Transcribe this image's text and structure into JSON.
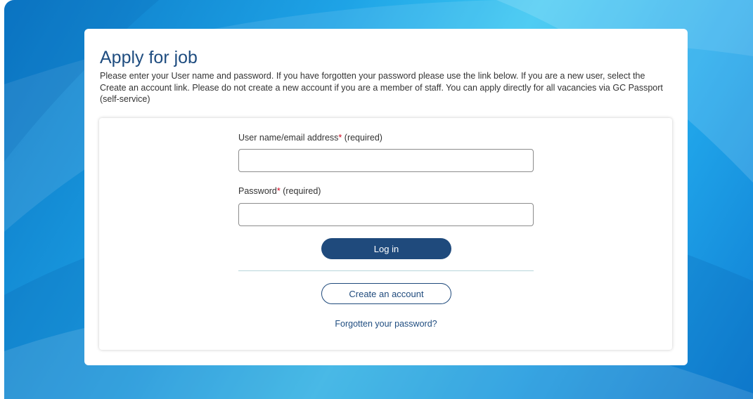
{
  "page": {
    "title": "Apply for job",
    "intro": "Please enter your User name and password. If you have forgotten your password please use the link below. If you are a new user, select the Create an account link. Please do not create a new account if you are a member of staff. You can apply directly for all vacancies via GC Passport (self-service)"
  },
  "login": {
    "username_label": "User name/email address",
    "username_value": "",
    "password_label": "Password",
    "password_value": "",
    "required_marker": "*",
    "required_text": "(required)",
    "login_button": "Log in",
    "create_account_button": "Create an account",
    "forgot_password_link": "Forgotten your password?"
  },
  "colors": {
    "title": "#1f4d80",
    "primary_button": "#1f4a7c",
    "required_marker": "#d0021b",
    "background_blue": "#1ea3e6"
  }
}
